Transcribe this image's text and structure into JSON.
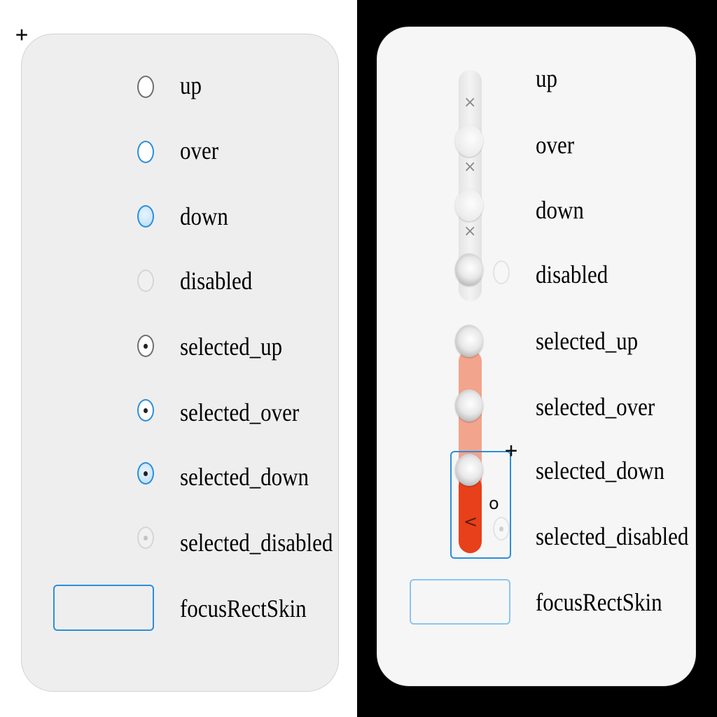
{
  "left_panel": {
    "items": [
      {
        "state": "up",
        "label": "up"
      },
      {
        "state": "over",
        "label": "over"
      },
      {
        "state": "down",
        "label": "down"
      },
      {
        "state": "disabled",
        "label": "disabled"
      },
      {
        "state": "selected_up",
        "label": "selected_up"
      },
      {
        "state": "selected_over",
        "label": "selected_over"
      },
      {
        "state": "selected_down",
        "label": "selected_down"
      },
      {
        "state": "selected_disabled",
        "label": "selected_disabled"
      }
    ],
    "focus_label": "focusRectSkin"
  },
  "right_panel": {
    "items": [
      {
        "label": "up"
      },
      {
        "label": "over"
      },
      {
        "label": "down"
      },
      {
        "label": "disabled"
      },
      {
        "label": "selected_up"
      },
      {
        "label": "selected_over"
      },
      {
        "label": "selected_down"
      },
      {
        "label": "selected_disabled"
      }
    ],
    "focus_label": "focusRectSkin",
    "glyphs": {
      "x_mark": "×",
      "chevron": "<",
      "o_mark": "o"
    }
  },
  "cursor_glyph": "+",
  "colors": {
    "accent_blue": "#2b8fdc",
    "toggle_red": "#e8401a",
    "toggle_salmon": "#f3a48c",
    "panel_grey": "#eeeeee"
  }
}
